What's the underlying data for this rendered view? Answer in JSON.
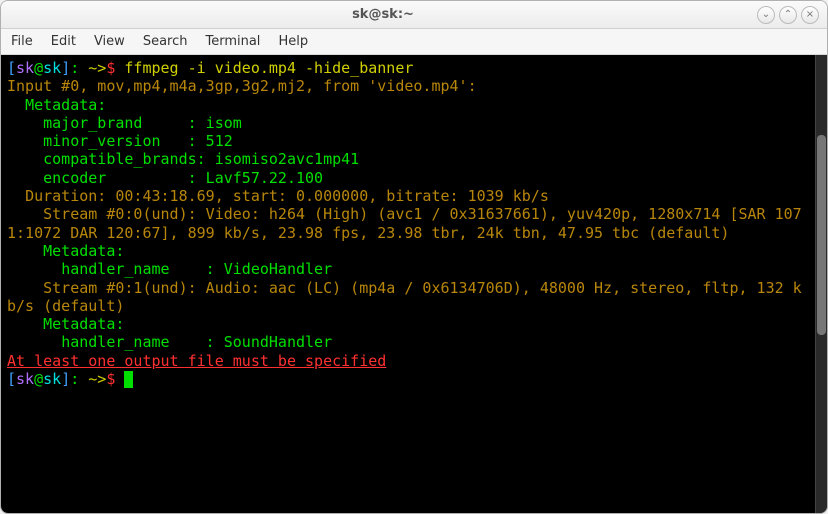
{
  "window": {
    "title": "sk@sk:~",
    "buttons": {
      "min": "⌄",
      "max": "⌃",
      "close": "×"
    }
  },
  "menubar": [
    "File",
    "Edit",
    "View",
    "Search",
    "Terminal",
    "Help"
  ],
  "prompt": {
    "lb": "[",
    "rb": "]",
    "user": "sk",
    "at": "@",
    "host": "sk",
    "sep": ": ",
    "path": "~>",
    "dollar": "$ "
  },
  "command": "ffmpeg -i video.mp4 -hide_banner",
  "output": [
    {
      "cls": "info",
      "text": "Input #0, mov,mp4,m4a,3gp,3g2,mj2, from 'video.mp4':"
    },
    {
      "cls": "",
      "text": "  Metadata:"
    },
    {
      "cls": "",
      "text": "    major_brand     : isom"
    },
    {
      "cls": "",
      "text": "    minor_version   : 512"
    },
    {
      "cls": "",
      "text": "    compatible_brands: isomiso2avc1mp41"
    },
    {
      "cls": "",
      "text": "    encoder         : Lavf57.22.100"
    },
    {
      "cls": "info",
      "text": "  Duration: 00:43:18.69, start: 0.000000, bitrate: 1039 kb/s"
    },
    {
      "cls": "info",
      "text": "    Stream #0:0(und): Video: h264 (High) (avc1 / 0x31637661), yuv420p, 1280x714 [SAR 1071:1072 DAR 120:67], 899 kb/s, 23.98 fps, 23.98 tbr, 24k tbn, 47.95 tbc (default)"
    },
    {
      "cls": "",
      "text": "    Metadata:"
    },
    {
      "cls": "",
      "text": "      handler_name    : VideoHandler"
    },
    {
      "cls": "info",
      "text": "    Stream #0:1(und): Audio: aac (LC) (mp4a / 0x6134706D), 48000 Hz, stereo, fltp, 132 kb/s (default)"
    },
    {
      "cls": "",
      "text": "    Metadata:"
    },
    {
      "cls": "",
      "text": "      handler_name    : SoundHandler"
    },
    {
      "cls": "err",
      "text": "At least one output file must be specified"
    }
  ]
}
